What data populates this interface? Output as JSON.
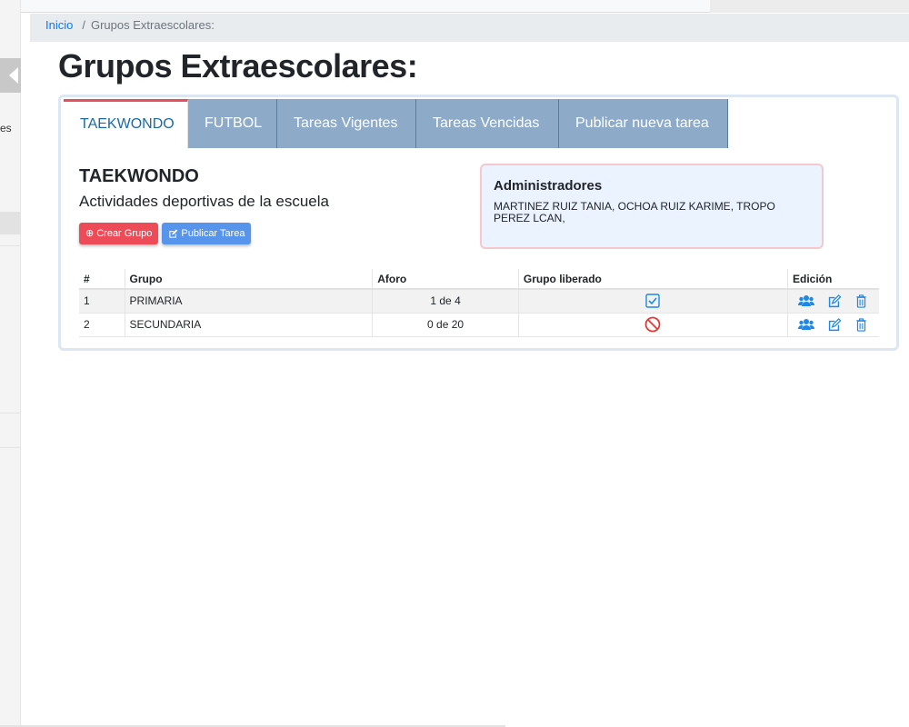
{
  "sidebar": {
    "partial_text": "es"
  },
  "breadcrumb": {
    "home": "Inicio",
    "separator": "/",
    "current": "Grupos Extraescolares:"
  },
  "page": {
    "title": "Grupos Extraescolares:"
  },
  "tabs": [
    {
      "label": "TAEKWONDO",
      "active": true
    },
    {
      "label": "FUTBOL",
      "active": false
    },
    {
      "label": "Tareas Vigentes",
      "active": false
    },
    {
      "label": "Tareas Vencidas",
      "active": false
    },
    {
      "label": "Publicar nueva tarea",
      "active": false
    }
  ],
  "activity": {
    "name": "TAEKWONDO",
    "description": "Actividades deportivas de la escuela",
    "create_group_label": "Crear Grupo",
    "publish_task_label": "Publicar Tarea"
  },
  "admins": {
    "title": "Administradores",
    "list": "MARTINEZ RUIZ TANIA, OCHOA RUIZ KARIME, TROPO PEREZ LCAN,"
  },
  "table": {
    "headers": [
      "#",
      "Grupo",
      "Aforo",
      "Grupo liberado",
      "Edición"
    ],
    "rows": [
      {
        "num": "1",
        "grupo": "PRIMARIA",
        "aforo": "1 de 4",
        "liberado": "checked-icon"
      },
      {
        "num": "2",
        "grupo": "SECUNDARIA",
        "aforo": "0 de 20",
        "liberado": "prohibited-icon"
      }
    ]
  },
  "colors": {
    "tab_inactive": "#8dabc8",
    "tab_active_text": "#1b6aa8",
    "tab_active_top": "#e2505f",
    "btn_red": "#ee4b59",
    "btn_blue": "#5795ed",
    "icon_blue": "#1e88e5",
    "icon_red": "#e53935"
  }
}
